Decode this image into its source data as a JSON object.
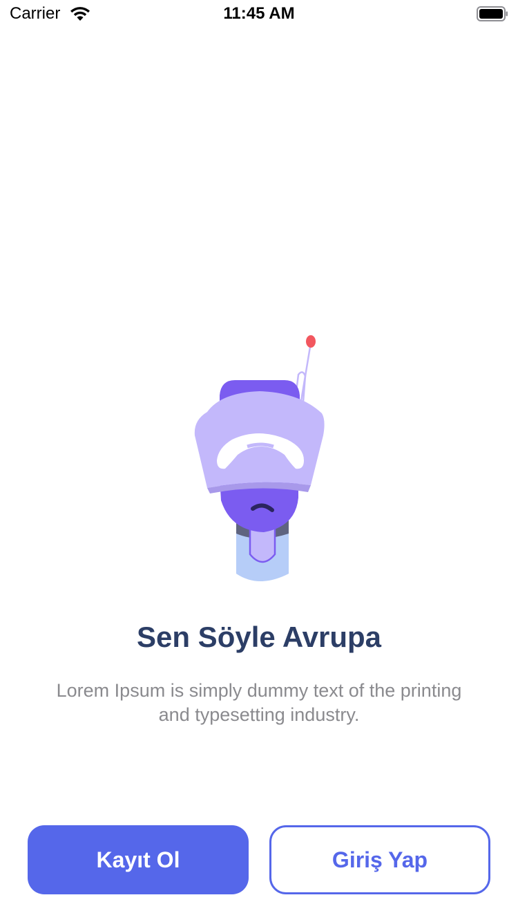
{
  "status_bar": {
    "carrier": "Carrier",
    "time": "11:45 AM",
    "icons": [
      "wifi-icon",
      "battery-icon"
    ]
  },
  "onboarding": {
    "illustration": "robot-illustration",
    "title": "Sen Söyle Avrupa",
    "description": "Lorem Ipsum is simply dummy text of the printing and typesetting industry."
  },
  "actions": {
    "register_label": "Kayıt Ol",
    "login_label": "Giriş Yap"
  },
  "colors": {
    "primary": "#5567ea",
    "title": "#2c3e66",
    "subtitle": "#8a8a8e",
    "robot_purple": "#7b5cf0",
    "robot_lavender": "#c3b8fb",
    "robot_blue": "#b6cdf8",
    "antenna_tip": "#f2575f"
  }
}
